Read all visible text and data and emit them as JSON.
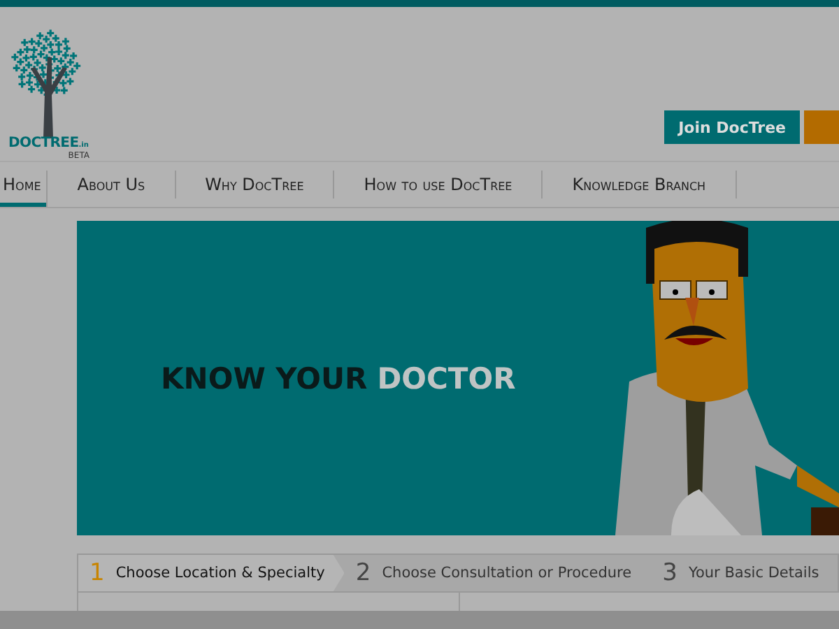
{
  "logo": {
    "name": "DOCTREE",
    "suffix": ".in",
    "tag": "BETA"
  },
  "header_buttons": [
    {
      "label": "Join DocTree",
      "kind": "primary"
    },
    {
      "kind": "accent"
    }
  ],
  "nav": [
    {
      "label": "Home",
      "selected": true
    },
    {
      "label": "About Us",
      "selected": false
    },
    {
      "label": "Why DocTree",
      "selected": false
    },
    {
      "label": "How to use DocTree",
      "selected": false
    },
    {
      "label": "Knowledge Branch",
      "selected": false
    }
  ],
  "banner": {
    "headline_lead": "KNOW YOUR",
    "headline_accent": "DOCTOR"
  },
  "steps": [
    {
      "number": "1",
      "label": "Choose Location & Specialty",
      "selected": true
    },
    {
      "number": "2",
      "label": "Choose Consultation or Procedure",
      "selected": false
    },
    {
      "number": "3",
      "label": "Your Basic Details",
      "selected": false
    }
  ]
}
